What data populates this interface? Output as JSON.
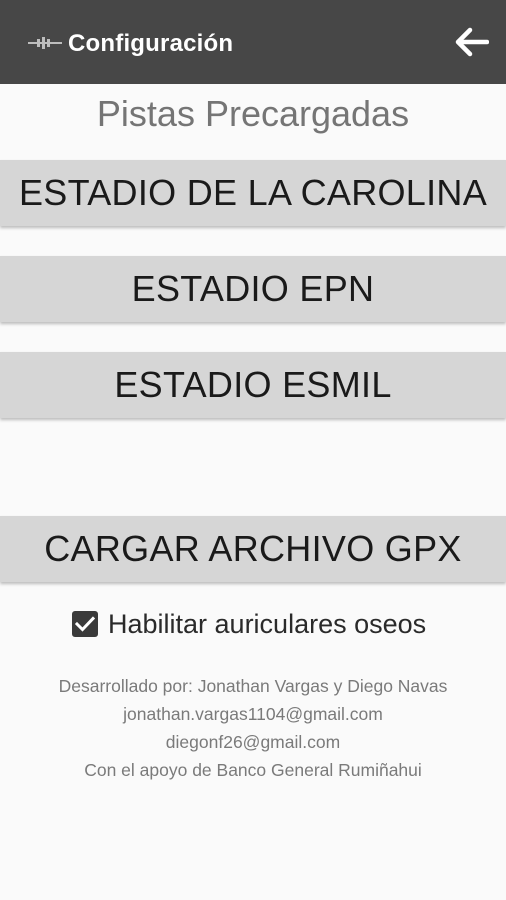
{
  "appbar": {
    "title": "Configuración",
    "logo_icon": "waveform-logo-icon",
    "back_icon": "arrow-left-icon",
    "background": "#474747"
  },
  "main": {
    "section_title": "Pistas Precargadas",
    "tracks": [
      {
        "label": "ESTADIO DE LA CAROLINA"
      },
      {
        "label": "ESTADIO EPN"
      },
      {
        "label": "ESTADIO ESMIL"
      }
    ],
    "load_gpx_label": "CARGAR ARCHIVO GPX",
    "bone_headphones": {
      "label": "Habilitar auriculares oseos",
      "checked": true
    }
  },
  "credits": {
    "line1": "Desarrollado por: Jonathan Vargas y Diego Navas",
    "line2": "jonathan.vargas1104@gmail.com",
    "line3": "diegonf26@gmail.com",
    "line4": "Con el apoyo de Banco General Rumiñahui"
  }
}
